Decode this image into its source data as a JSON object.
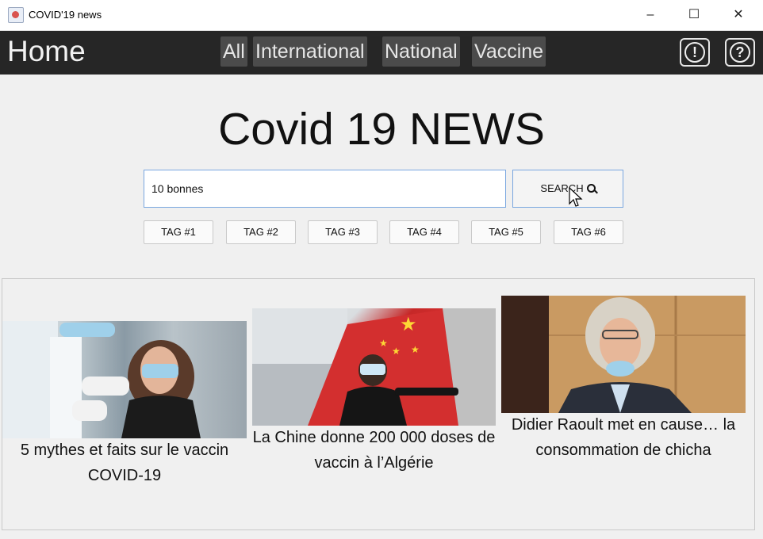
{
  "window": {
    "title": "COVID'19 news",
    "controls": {
      "minimize": "–",
      "maximize": "☐",
      "close": "✕"
    }
  },
  "navbar": {
    "title": "Home",
    "tabs": [
      "All",
      "International",
      "National",
      "Vaccine"
    ],
    "icons": {
      "alert": "alert-icon",
      "help": "help-icon"
    },
    "alert_glyph": "!",
    "help_glyph": "?"
  },
  "main": {
    "heading": "Covid 19 NEWS",
    "search": {
      "value": "10 bonnes",
      "button_label": "SEARCH"
    },
    "tags": [
      "TAG #1",
      "TAG #2",
      "TAG #3",
      "TAG #4",
      "TAG #5",
      "TAG #6"
    ]
  },
  "news": [
    {
      "caption": "5 mythes et faits sur le vaccin COVID-19"
    },
    {
      "caption": "La Chine donne 200 000 doses de vaccin à l’Algérie"
    },
    {
      "caption": "Didier Raoult met en cause… la consommation de chicha"
    }
  ],
  "colors": {
    "navbar": "#262626",
    "tab": "#4b4b4b",
    "accent_border": "#7aa7e0"
  }
}
